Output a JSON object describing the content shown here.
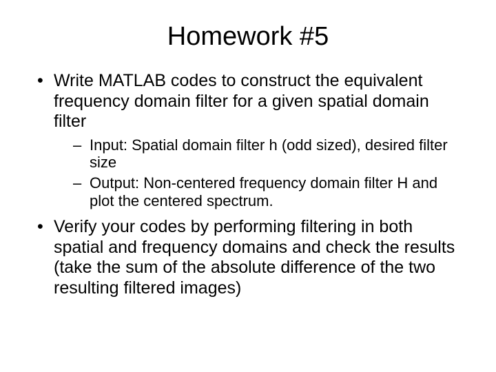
{
  "title": "Homework #5",
  "bullets": [
    {
      "text": "Write MATLAB codes to construct the equivalent frequency domain filter for a given spatial domain filter",
      "subs": [
        "Input: Spatial domain filter h (odd sized), desired filter size",
        "Output: Non-centered frequency domain filter H and plot the centered spectrum."
      ]
    },
    {
      "text": "Verify your codes by performing filtering in both spatial and frequency domains and check the results (take the sum of the absolute difference of the two resulting filtered images)",
      "subs": []
    }
  ]
}
